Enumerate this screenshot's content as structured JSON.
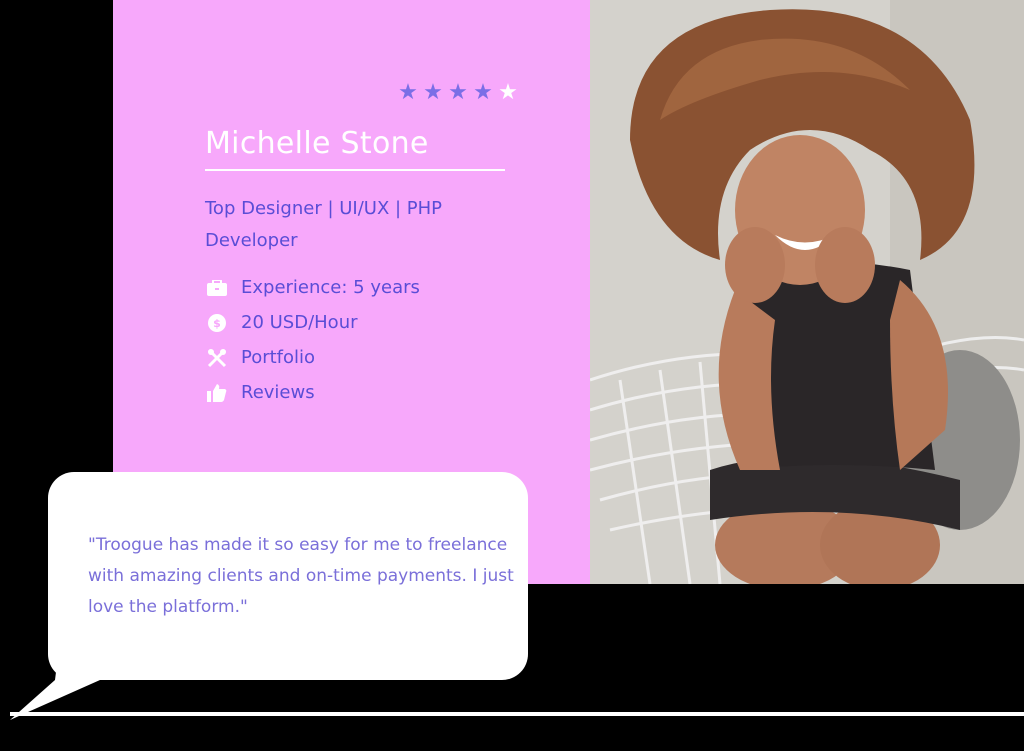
{
  "profile": {
    "name": "Michelle Stone",
    "title": "Top Designer | UI/UX | PHP Developer",
    "rating": {
      "filled": 4,
      "total": 5,
      "filled_color": "#7b6ee6",
      "empty_color": "#ffffff"
    },
    "details": [
      {
        "icon": "briefcase-icon",
        "label": "Experience: 5 years"
      },
      {
        "icon": "dollar-coin-icon",
        "label": "20 USD/Hour"
      },
      {
        "icon": "tools-icon",
        "label": "Portfolio"
      },
      {
        "icon": "thumbs-up-icon",
        "label": "Reviews"
      }
    ]
  },
  "testimonial": {
    "quote": "\"Troogue has made it so easy for me to freelance with amazing clients and on-time payments. I just love the platform.\""
  },
  "colors": {
    "card_background": "#f7a8fb",
    "accent_text": "#5a4dd6",
    "quote_text": "#7a6fd9",
    "page_background": "#000000"
  }
}
